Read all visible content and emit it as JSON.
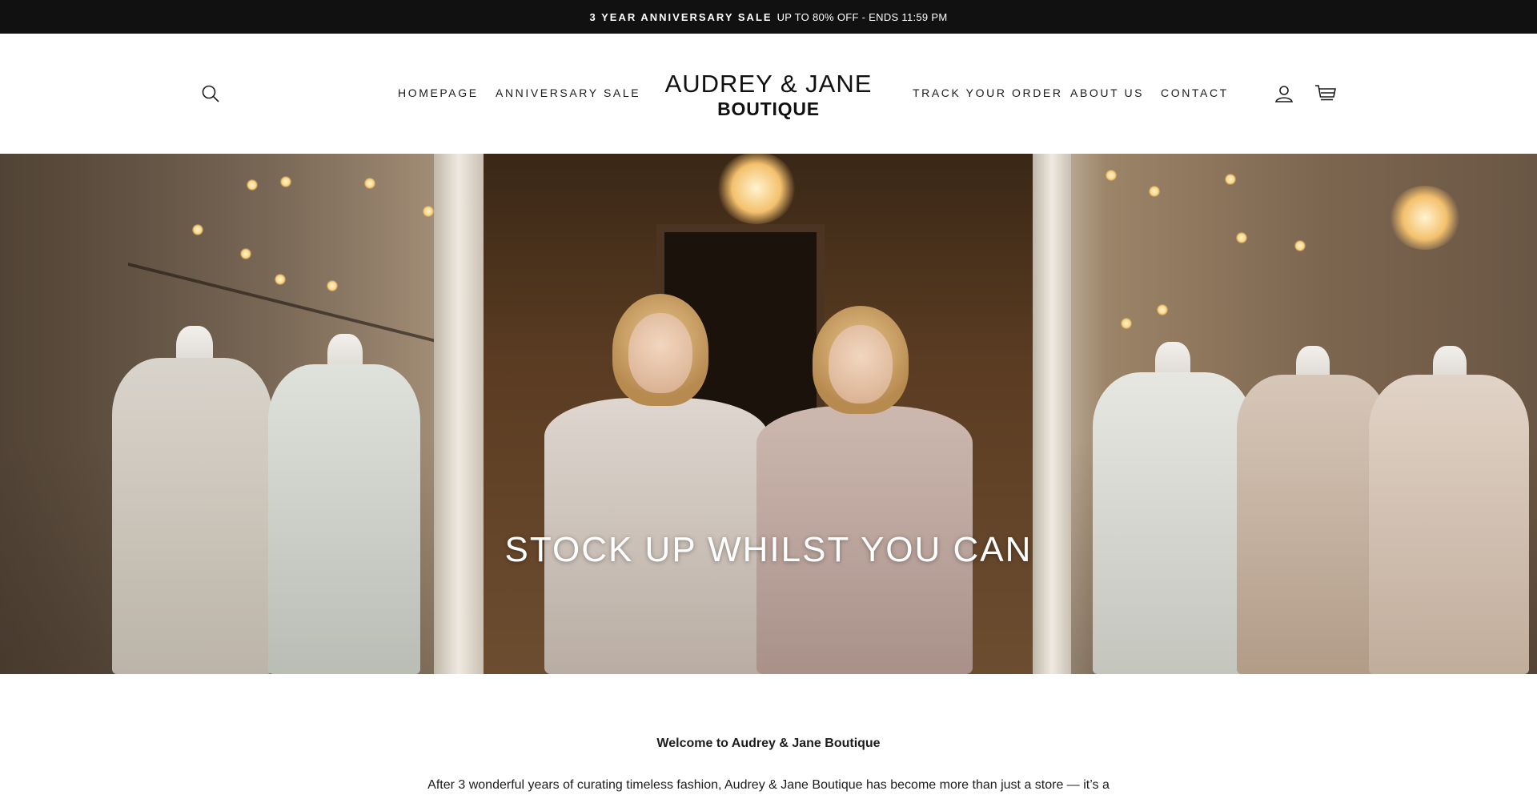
{
  "announcement": {
    "highlight": "3 YEAR ANNIVERSARY SALE",
    "text": "UP TO 80% OFF - ENDS 11:59 PM"
  },
  "header": {
    "nav_left": [
      {
        "label": "HOMEPAGE"
      },
      {
        "label": "ANNIVERSARY SALE"
      }
    ],
    "nav_right": [
      {
        "label": "TRACK YOUR ORDER"
      },
      {
        "label": "ABOUT US"
      },
      {
        "label": "CONTACT"
      }
    ],
    "logo": {
      "line1": "AUDREY & JANE",
      "line2": "BOUTIQUE"
    },
    "icons": {
      "search": "search-icon",
      "account": "user-icon",
      "cart": "cart-icon"
    }
  },
  "hero": {
    "title": "STOCK UP WHILST YOU CAN"
  },
  "welcome": {
    "title": "Welcome to Audrey & Jane Boutique",
    "text": "After 3 wonderful years of curating timeless fashion, Audrey & Jane Boutique has become more than just a store — it’s a"
  },
  "colors": {
    "announcement_bg": "#111111",
    "text": "#1c1c1c",
    "background": "#ffffff"
  }
}
